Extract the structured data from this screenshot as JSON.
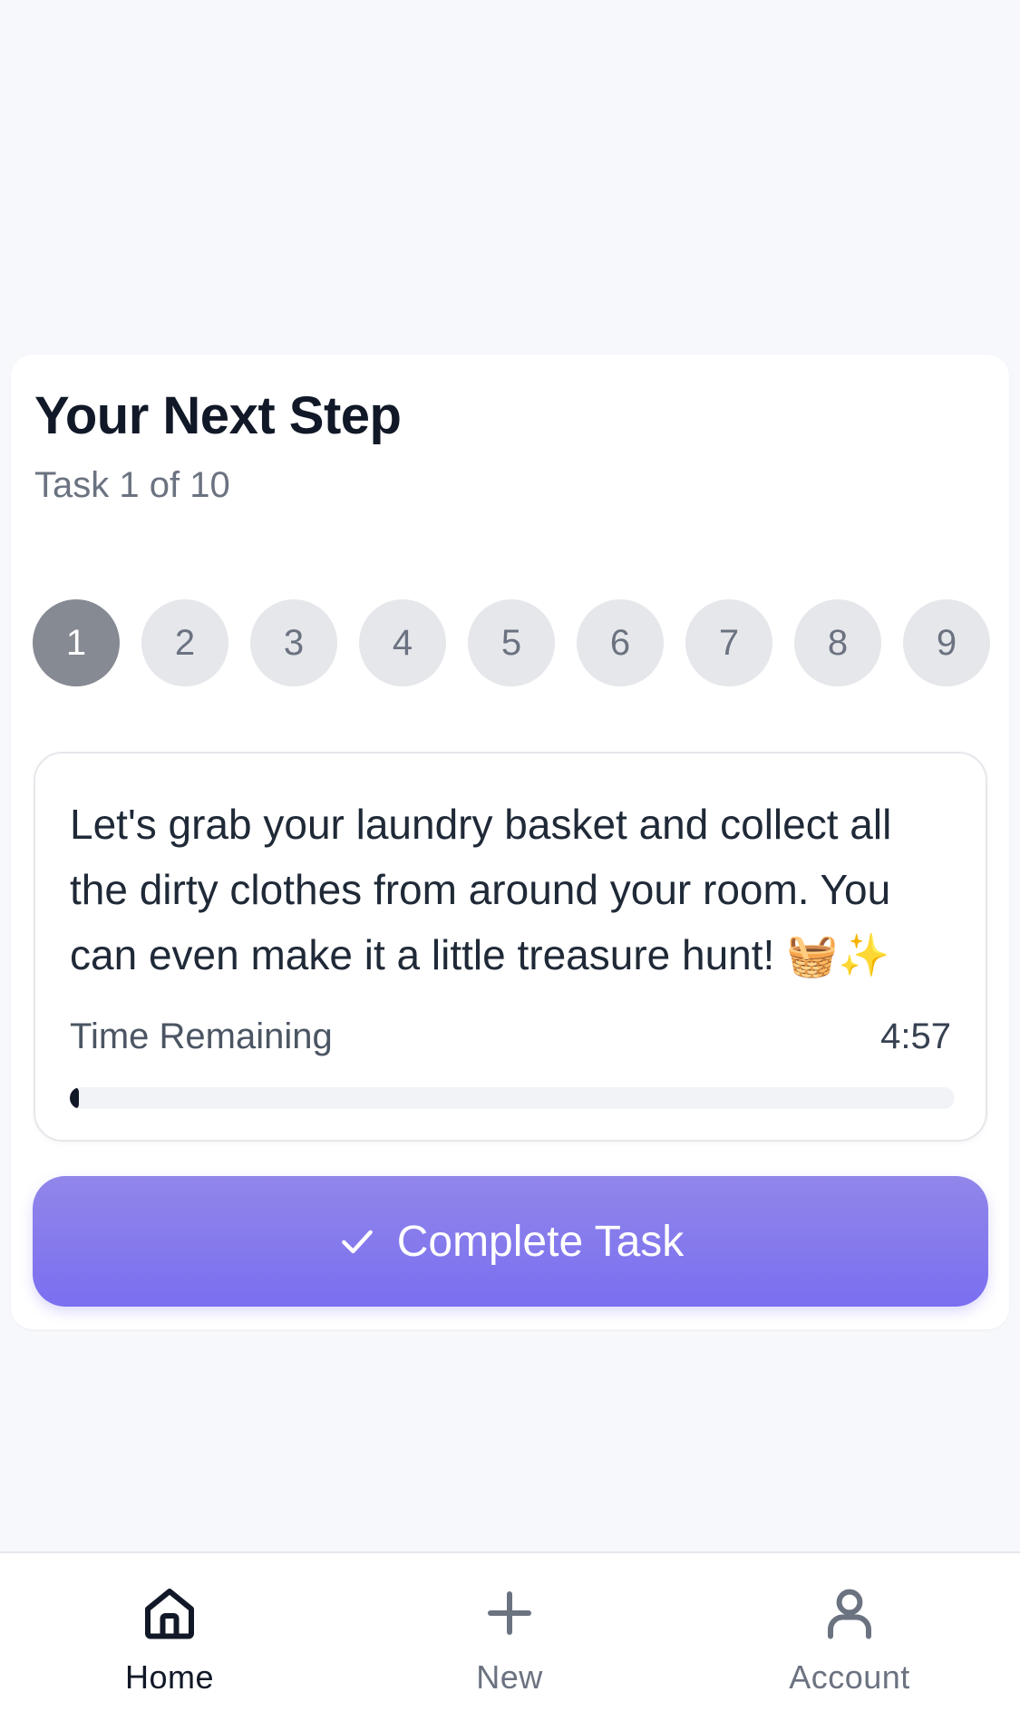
{
  "card": {
    "title": "Your Next Step",
    "subtitle": "Task 1 of 10"
  },
  "steps": {
    "items": [
      "1",
      "2",
      "3",
      "4",
      "5",
      "6",
      "7",
      "8",
      "9"
    ],
    "active_index": 0
  },
  "task": {
    "text": "Let's grab your laundry basket and collect all the dirty clothes from around your room. You can even make it a little treasure hunt! 🧺✨",
    "time_label": "Time Remaining",
    "time_value": "4:57",
    "progress_fraction": 0.01
  },
  "complete_button": {
    "icon": "check-icon",
    "label": "Complete Task"
  },
  "nav": {
    "items": [
      {
        "label": "Home",
        "icon": "home-icon",
        "active": true
      },
      {
        "label": "New",
        "icon": "plus-icon",
        "active": false
      },
      {
        "label": "Account",
        "icon": "user-icon",
        "active": false
      }
    ]
  },
  "colors": {
    "accent_top": "#9186e9",
    "accent_bottom": "#7a6ff0",
    "active_step": "#868a93",
    "inactive_step": "#e5e7eb"
  }
}
